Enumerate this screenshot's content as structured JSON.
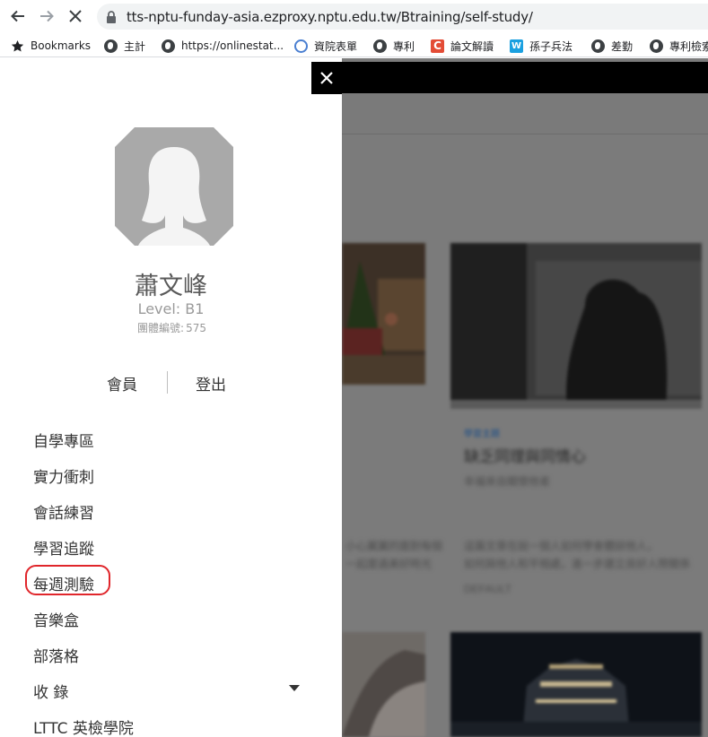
{
  "browser": {
    "url": "tts-nptu-funday-asia.ezproxy.nptu.edu.tw/Btraining/self-study/",
    "bookmarks": [
      {
        "label": "Bookmarks",
        "icon": "star-icon"
      },
      {
        "label": "主計",
        "icon": "globe-icon"
      },
      {
        "label": "https://onlinestat...",
        "icon": "globe-icon"
      },
      {
        "label": "資院表單",
        "icon": "c-ring-icon"
      },
      {
        "label": "專利",
        "icon": "globe-icon"
      },
      {
        "label": "論文解讀",
        "icon": "c-logo-icon"
      },
      {
        "label": "孫子兵法",
        "icon": "w-logo-icon"
      },
      {
        "label": "差勤",
        "icon": "globe-icon"
      },
      {
        "label": "專利檢索",
        "icon": "globe-icon"
      }
    ]
  },
  "drawer": {
    "close_label": "×",
    "user": {
      "name": "蕭文峰",
      "level": "Level: B1",
      "group_label": "團體編號:",
      "group_id": "575"
    },
    "account": {
      "member": "會員",
      "logout": "登出"
    },
    "menu": [
      {
        "label": "自學專區"
      },
      {
        "label": "實力衝刺"
      },
      {
        "label": "會話練習"
      },
      {
        "label": "學習追蹤"
      },
      {
        "label": "每週測驗"
      },
      {
        "label": "音樂盒"
      },
      {
        "label": "部落格"
      },
      {
        "label": "收 錄"
      },
      {
        "label": "LTTC 英檢學院"
      }
    ]
  },
  "background_page": {
    "card_tag": "學習主題",
    "card_title": "缺乏同理與同情心",
    "card_subtitle": "幸福來自關懷他者",
    "card_excerpt_1": "這篇文章在說一個人如何學會體諒他人，",
    "card_excerpt_2": "如何與他人和平相處，進一步建立良好人際關係",
    "card_meta": "DEFAULT",
    "left_excerpt_1": "小心翼翼的面對每個",
    "left_excerpt_2": "一起度過美好時光"
  },
  "colors": {
    "accent_highlight": "#e0262b",
    "drawer_bg": "#ffffff",
    "overlay": "#7b7b7b"
  }
}
